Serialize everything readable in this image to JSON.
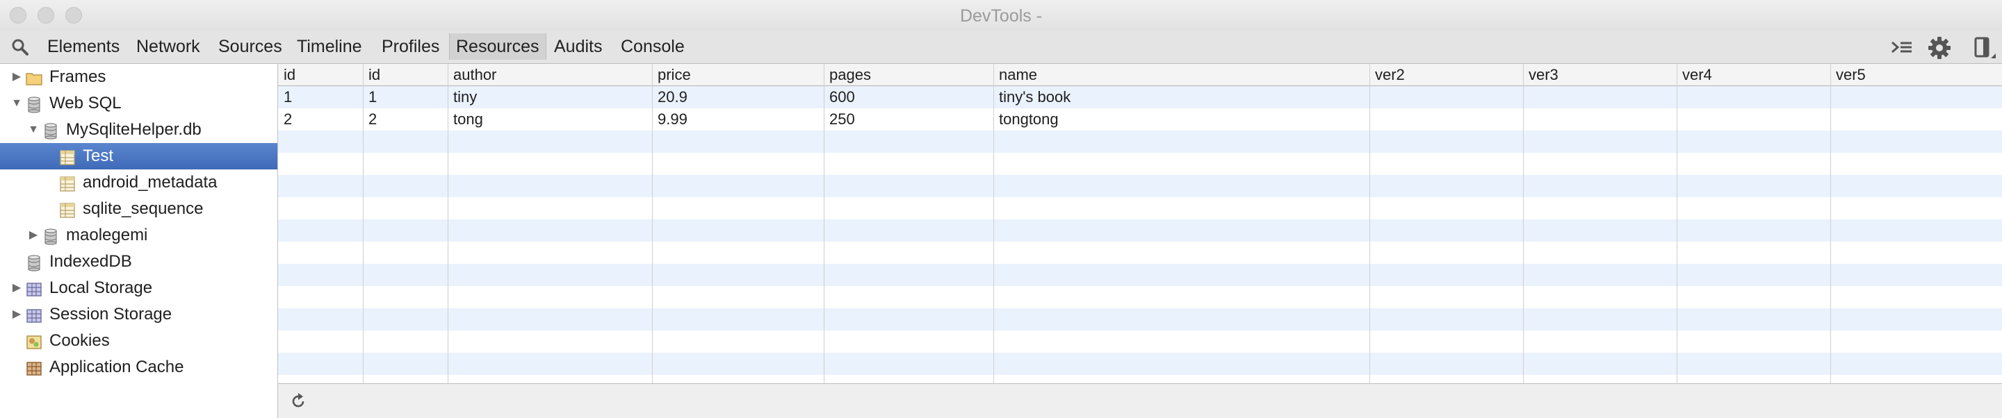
{
  "window": {
    "title": "DevTools -"
  },
  "toolbar": {
    "tabs": [
      "Elements",
      "Network",
      "Sources",
      "Timeline",
      "Profiles",
      "Resources",
      "Audits",
      "Console"
    ],
    "selected_tab": "Resources"
  },
  "sidebar": {
    "items": [
      {
        "label": "Frames",
        "icon": "folder-icon",
        "expander": "collapsed"
      },
      {
        "label": "Web SQL",
        "icon": "database-icon",
        "expander": "expanded"
      },
      {
        "label": "MySqliteHelper.db",
        "icon": "database-icon",
        "expander": "expanded"
      },
      {
        "label": "Test",
        "icon": "table-icon",
        "selected": true
      },
      {
        "label": "android_metadata",
        "icon": "table-icon"
      },
      {
        "label": "sqlite_sequence",
        "icon": "table-icon"
      },
      {
        "label": "maolegemi",
        "icon": "database-icon",
        "expander": "collapsed"
      },
      {
        "label": "IndexedDB",
        "icon": "database-icon"
      },
      {
        "label": "Local Storage",
        "icon": "grid-storage-icon",
        "expander": "collapsed"
      },
      {
        "label": "Session Storage",
        "icon": "grid-storage-icon",
        "expander": "collapsed"
      },
      {
        "label": "Cookies",
        "icon": "cookie-icon"
      },
      {
        "label": "Application Cache",
        "icon": "app-cache-icon"
      }
    ]
  },
  "table": {
    "columns": [
      "id",
      "id",
      "author",
      "price",
      "pages",
      "name",
      "ver2",
      "ver3",
      "ver4",
      "ver5"
    ],
    "rows": [
      [
        "1",
        "1",
        "tiny",
        "20.9",
        "600",
        "tiny's book",
        "",
        "",
        "",
        ""
      ],
      [
        "2",
        "2",
        "tong",
        "9.99",
        "250",
        "tongtong",
        "",
        "",
        "",
        ""
      ]
    ]
  },
  "statusbar": {
    "refresh_icon": "refresh-icon"
  },
  "colors": {
    "selection": "#3e6ab8",
    "row_stripe": "#eaf2fd"
  }
}
